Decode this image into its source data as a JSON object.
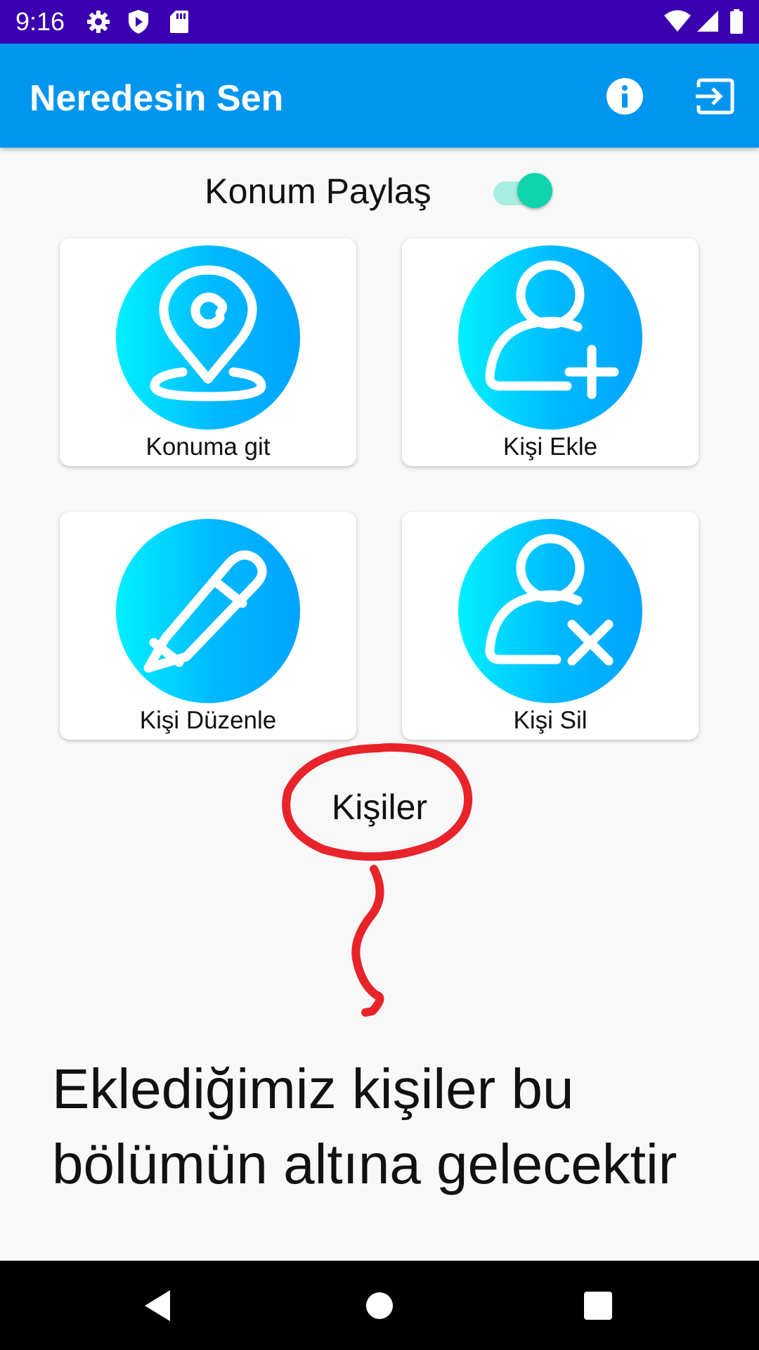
{
  "status_bar": {
    "time": "9:16",
    "left_icons": [
      "gear-icon",
      "shield-play-icon",
      "sd-card-icon"
    ],
    "right_icons": [
      "wifi-icon",
      "cellular-signal-icon",
      "battery-icon"
    ],
    "background": "#3a00b0"
  },
  "app_bar": {
    "title": "Neredesin Sen",
    "background": "#0096f0",
    "actions": [
      "info-icon",
      "logout-icon"
    ]
  },
  "location_share": {
    "label": "Konum Paylaş",
    "enabled": true,
    "accent": "#10d4ae"
  },
  "cards": [
    {
      "label": "Konuma git",
      "icon": "location-pin-icon"
    },
    {
      "label": "Kişi Ekle",
      "icon": "add-person-icon"
    },
    {
      "label": "Kişi Düzenle",
      "icon": "pencil-icon"
    },
    {
      "label": "Kişi Sil",
      "icon": "remove-person-icon"
    }
  ],
  "contacts_section": {
    "title": "Kişiler"
  },
  "annotation": {
    "text": "Eklediğimiz kişiler bu bölümün altına gelecektir",
    "color": "#e8232a"
  },
  "nav_bar": {
    "buttons": [
      "back-icon",
      "home-icon",
      "recents-icon"
    ]
  }
}
